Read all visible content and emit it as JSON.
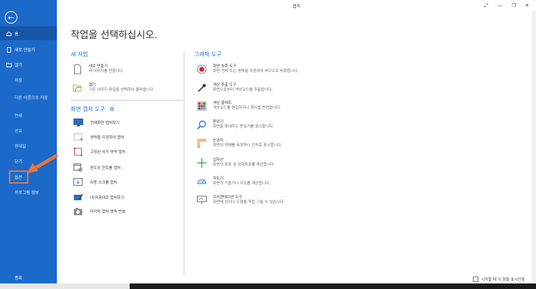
{
  "window": {
    "title": "캡쳐",
    "minimize": "—",
    "restore": "❐",
    "close": "✕",
    "pin": "⤢"
  },
  "sidebar": {
    "items": [
      {
        "label": "홈",
        "icon": "home-icon"
      },
      {
        "label": "새로 만들기",
        "icon": "new-file-icon"
      },
      {
        "label": "열기",
        "icon": "folder-icon"
      },
      {
        "label": "저장"
      },
      {
        "label": "다른 이름으로 저장"
      },
      {
        "label": "인쇄"
      },
      {
        "label": "공유"
      },
      {
        "label": "뭔데일"
      },
      {
        "label": "닫기"
      },
      {
        "label": "옵션"
      },
      {
        "label": "프로그램 정보"
      },
      {
        "label": "종료"
      }
    ]
  },
  "main": {
    "heading": "작업을 선택하십시오.",
    "new_work": {
      "title": "새 작업",
      "items": [
        {
          "title": "새로 만들기",
          "desc": "새 이미지를 만듭니다."
        },
        {
          "title": "열기",
          "desc": "기존 이미지 파일을 선택하여 불러옵니다."
        }
      ]
    },
    "capture_tools": {
      "title": "화면 캡처 도구",
      "items": [
        "전체화면 캡처하기",
        "영역을 지정하여 캡처",
        "고정된 사각 영역 캡처",
        "윈도우 컨트롤 캡처",
        "자동 스크롤 캡처",
        "내 마음대로 캡처하기",
        "마지막 캡처 영역 반복"
      ]
    },
    "graphic_tools": {
      "title": "그래픽 도구",
      "items": [
        {
          "title": "화면 녹화 도구",
          "desc": "화면 전체 또는 영역을 지정하여 비디오로 녹화합니다."
        },
        {
          "title": "색상 추출 도구",
          "desc": "화면으로부터 색상코드를 추출합니다."
        },
        {
          "title": "색상 팔레트",
          "desc": "색상코드를 편집하거나 형식을 변경합니다."
        },
        {
          "title": "돋보기",
          "desc": "화면을 확대하는 돋보기를 표시합니다."
        },
        {
          "title": "눈금자",
          "desc": "화면의 객체를 측정하나 인치로 표시합니다."
        },
        {
          "title": "십자선",
          "desc": "화면의 좌표 및 상대좌표를 계산합니다."
        },
        {
          "title": "각도기",
          "desc": "화면의 기울기나 각도를 계산합니다."
        },
        {
          "title": "프리젠테이션 도구",
          "desc": "화면에 선이나 도형을 직접 그릴 수 있습니다."
        }
      ]
    }
  },
  "footer": {
    "startup_checkbox": "시작할 때 이 창을 표시안함"
  },
  "colors": {
    "sidebar": "#1b6ac9",
    "accent": "#1b6ac9",
    "highlight": "#e8743a"
  }
}
